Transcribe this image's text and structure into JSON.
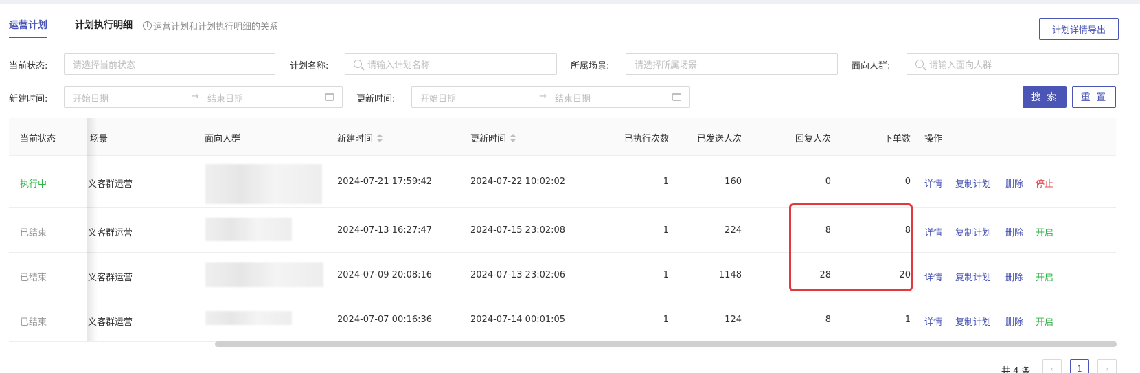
{
  "tabs": [
    {
      "label": "运营计划"
    },
    {
      "label": "计划执行明细"
    }
  ],
  "tab_hint": "运营计划和计划执行明细的关系",
  "export_button": "计划详情导出",
  "filters": {
    "status_label": "当前状态:",
    "status_placeholder": "请选择当前状态",
    "name_label": "计划名称:",
    "name_placeholder": "请输入计划名称",
    "scene_label": "所属场景:",
    "scene_placeholder": "请选择所属场景",
    "audience_label": "面向人群:",
    "audience_placeholder": "请输入面向人群",
    "created_label": "新建时间:",
    "created_start": "开始日期",
    "created_end": "结束日期",
    "updated_label": "更新时间:",
    "updated_start": "开始日期",
    "updated_end": "结束日期",
    "range_arrow": "→",
    "search_button": "搜 索",
    "reset_button": "重 置"
  },
  "table": {
    "headers": {
      "status": "当前状态",
      "scene": "场景",
      "audience": "面向人群",
      "created": "新建时间",
      "updated": "更新时间",
      "executed": "已执行次数",
      "sent": "已发送人次",
      "replies": "回复人次",
      "orders": "下单数",
      "actions": "操作"
    },
    "rows": [
      {
        "status": "执行中",
        "scene": "义客群运营",
        "created": "2024-07-21 17:59:42",
        "updated": "2024-07-22 10:02:02",
        "executed": "1",
        "sent": "160",
        "replies": "0",
        "orders": "0",
        "op_detail": "详情",
        "op_copy": "复制计划",
        "op_delete": "删除",
        "op_toggle": "停止"
      },
      {
        "status": "已结束",
        "scene": "义客群运营",
        "created": "2024-07-13 16:27:47",
        "updated": "2024-07-15 23:02:08",
        "executed": "1",
        "sent": "224",
        "replies": "8",
        "orders": "8",
        "op_detail": "详情",
        "op_copy": "复制计划",
        "op_delete": "删除",
        "op_toggle": "开启"
      },
      {
        "status": "已结束",
        "scene": "义客群运营",
        "created": "2024-07-09 20:08:16",
        "updated": "2024-07-13 23:02:06",
        "executed": "1",
        "sent": "1148",
        "replies": "28",
        "orders": "20",
        "op_detail": "详情",
        "op_copy": "复制计划",
        "op_delete": "删除",
        "op_toggle": "开启"
      },
      {
        "status": "已结束",
        "scene": "义客群运营",
        "created": "2024-07-07 00:16:36",
        "updated": "2024-07-14 00:01:05",
        "executed": "1",
        "sent": "124",
        "replies": "8",
        "orders": "1",
        "op_detail": "详情",
        "op_copy": "复制计划",
        "op_delete": "删除",
        "op_toggle": "开启"
      }
    ]
  },
  "pagination": {
    "total": "共 4 条",
    "current_page": "1",
    "prev_icon": "chevron-left-icon",
    "next_icon": "chevron-right-icon"
  },
  "colors": {
    "accent": "#4a55b5",
    "running": "#2fb344",
    "stop": "#e5484d",
    "highlight": "#e0393e"
  }
}
